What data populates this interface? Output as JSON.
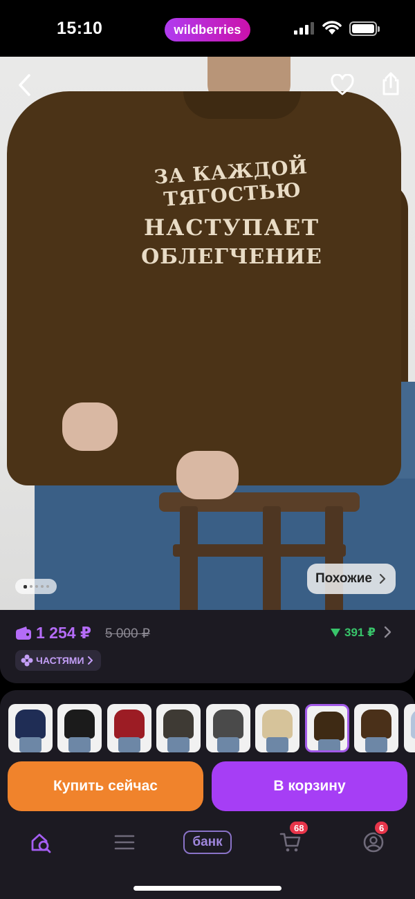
{
  "status_bar": {
    "time": "15:10",
    "brand": "wildberries"
  },
  "hero": {
    "print_lines": [
      "ЗА КАЖДОЙ ТЯГОСТЬЮ",
      "НАСТУПАЕТ",
      "ОБЛЕГЧЕНИЕ"
    ],
    "similar_label": "Похожие",
    "icons": {
      "back": "chevron-left-icon",
      "favorite": "heart-icon",
      "share": "share-icon"
    },
    "pager": {
      "total": 5,
      "active": 1
    }
  },
  "price_panel": {
    "price": "1 254 ₽",
    "old_price": "5 000 ₽",
    "cashback": "391 ₽",
    "installments": "ЧАСТЯМИ"
  },
  "variants": [
    {
      "color": "#1f2d55"
    },
    {
      "color": "#1b1b1b"
    },
    {
      "color": "#9c1c24"
    },
    {
      "color": "#3e3a34"
    },
    {
      "color": "#4a4a4a"
    },
    {
      "color": "#d6c39a"
    },
    {
      "color": "#3e2a14",
      "selected": true
    },
    {
      "color": "#4a3019"
    },
    {
      "color": "#b4c4dc"
    }
  ],
  "actions": {
    "buy_now": "Купить сейчас",
    "add_to_cart": "В корзину"
  },
  "tabbar": {
    "bank_label": "банк",
    "cart_badge": "68",
    "profile_badge": "6"
  },
  "colors": {
    "accent": "#a63ef5",
    "buy": "#f0832c",
    "price": "#b46cf7",
    "cashback": "#38c46a",
    "badge": "#e8354a"
  }
}
